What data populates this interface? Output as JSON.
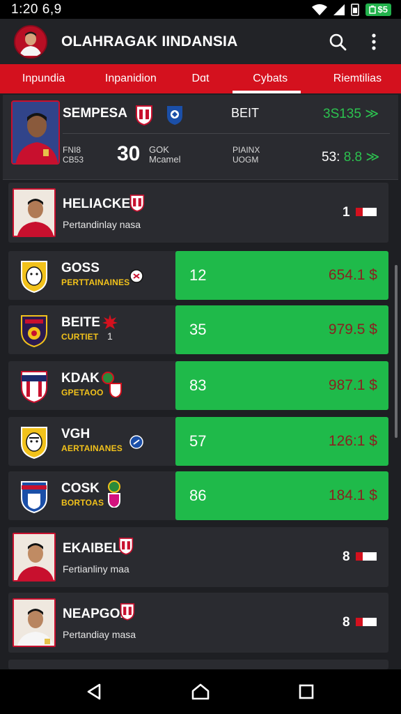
{
  "status_bar": {
    "time": "1:20 6,9",
    "battery_text": "$5"
  },
  "header": {
    "title": "OLAHRAGAK IINDANSIA"
  },
  "tabs": [
    {
      "label": "Inpundia"
    },
    {
      "label": "Inpanidion"
    },
    {
      "label": "Dɑt"
    },
    {
      "label": "Cybats"
    },
    {
      "label": "Riemtilias"
    }
  ],
  "feature": {
    "name": "SEMPESA",
    "col2": "BEIT",
    "price_top": "3S135 ≫",
    "stat_left_1": "FNI8",
    "stat_left_2": "CB53",
    "big_number": "30",
    "stat_mid_1": "GOK",
    "stat_mid_2": "Mcamel",
    "stat_right_1": "PIAINX",
    "stat_right_2": "UOGM",
    "price_bottom_prefix": "53:",
    "price_bottom_value": "8.8 ≫"
  },
  "rows": [
    {
      "name": "HELIACKE",
      "sub": "Pertandinlay nasa",
      "rank": "1"
    },
    {
      "name": "GOSS",
      "sub": "PERTTAINAINES",
      "value": "12",
      "price": "654.1 $"
    },
    {
      "name": "BEITE",
      "sub": "CURTIET",
      "sub2": "1",
      "value": "35",
      "price": "979.5 $"
    },
    {
      "name": "KDAK",
      "sub": "GPETAOO",
      "value": "83",
      "price": "987.1 $"
    },
    {
      "name": "VGH",
      "sub": "AERTAINANES",
      "value": "57",
      "price": "126:1 $"
    },
    {
      "name": "COSK",
      "sub": "BORTOAS",
      "value": "86",
      "price": "184.1 $"
    },
    {
      "name": "EKAIBEL",
      "sub": "Fertianliny maa",
      "rank": "8"
    },
    {
      "name": "NEAPGOE",
      "sub": "Pertandiay masa",
      "rank": "8"
    }
  ]
}
